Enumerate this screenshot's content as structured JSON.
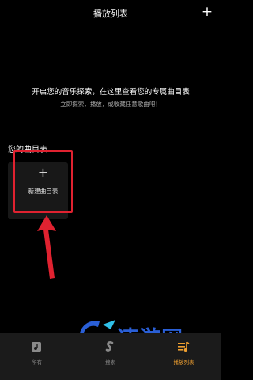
{
  "header": {
    "title": "播放列表",
    "add_icon": "plus-icon"
  },
  "empty_state": {
    "headline": "开启您的音乐探索，在这里查看您的专属曲目表",
    "subtitle": "立即探索，播放，或收藏任意歌曲吧！"
  },
  "playlists": {
    "section_title": "您的曲目表",
    "new_label": "新建曲目表"
  },
  "annotations": {
    "arrow_color": "#e02230",
    "highlight_color": "#e02230"
  },
  "watermark": {
    "text": "速游网"
  },
  "tabs": [
    {
      "label": "所有",
      "icon": "library-icon",
      "active": false
    },
    {
      "label": "搜索",
      "icon": "search-icon",
      "active": false
    },
    {
      "label": "播放列表",
      "icon": "playlist-icon",
      "active": true
    }
  ],
  "colors": {
    "background": "#000000",
    "tabbar": "#1b1b1b",
    "accent": "#f0a030"
  }
}
